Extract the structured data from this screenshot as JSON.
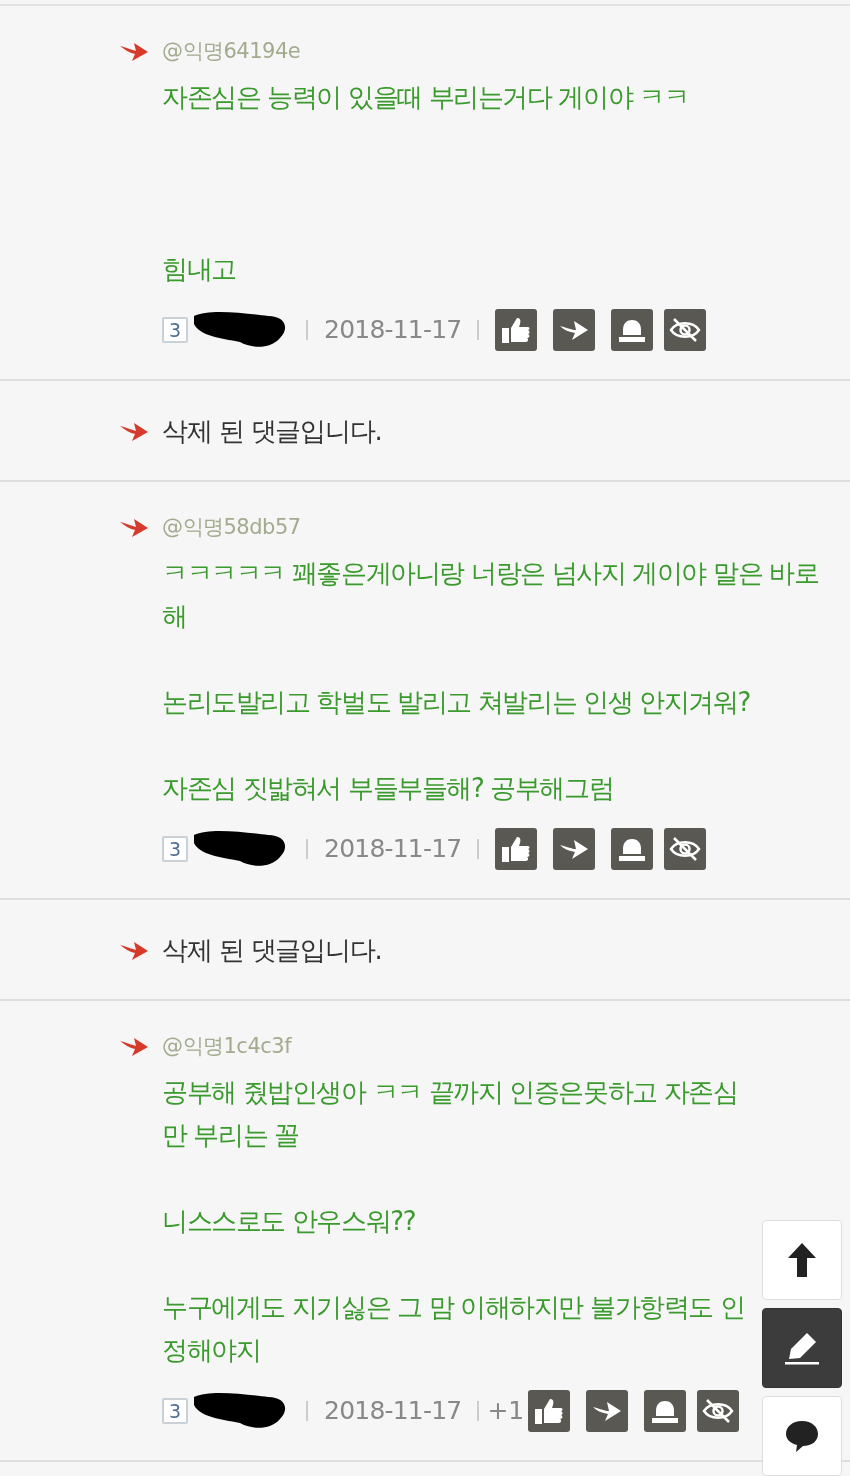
{
  "comments": [
    {
      "kind": "reply",
      "mention": "@익명64194e",
      "body": "자존심은 능력이 있을때 부리는거다 게이야 ㅋㅋ\n\n\n\n힘내고",
      "level_badge": "3",
      "date": "2018-11-17"
    },
    {
      "kind": "deleted",
      "body": "삭제 된 댓글입니다."
    },
    {
      "kind": "reply",
      "mention": "@익명58db57",
      "body": "ㅋㅋㅋㅋㅋ 꽤좋은게아니랑 너랑은 넘사지 게이야 말은 바로해\n\n논리도발리고 학벌도 발리고 쳐발리는 인생 안지겨워?\n\n자존심 짓밟혀서 부들부들해? 공부해그럼",
      "level_badge": "3",
      "date": "2018-11-17"
    },
    {
      "kind": "deleted",
      "body": "삭제 된 댓글입니다."
    },
    {
      "kind": "reply",
      "mention": "@익명1c4c3f",
      "body": "공부해 줬밥인생아 ㅋㅋ 끝까지 인증은못하고 자존심만 부리는 꼴\n\n니스스로도 안우스워??\n\n누구에게도 지기싫은 그 맘 이해하지만 불가항력도 인정해야지",
      "level_badge": "3",
      "date": "2018-11-17",
      "recommend_count": "+1"
    }
  ]
}
